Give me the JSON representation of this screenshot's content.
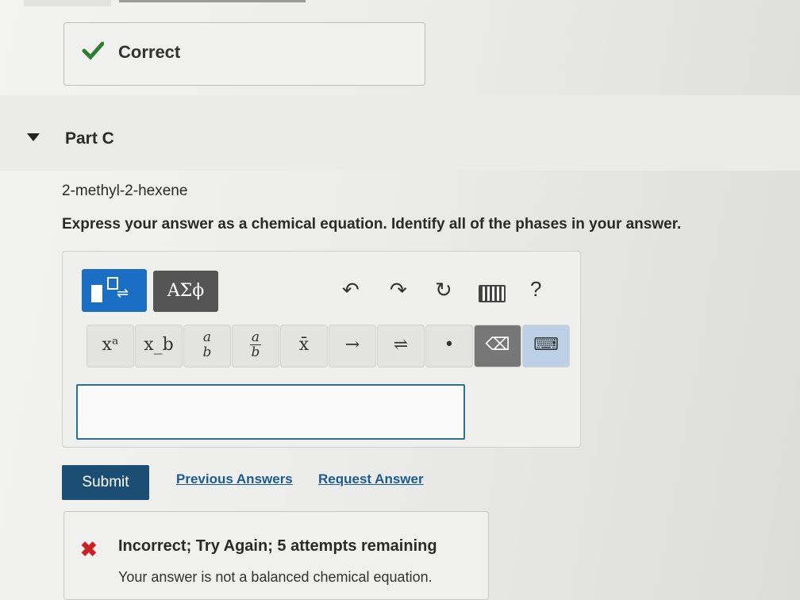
{
  "prev_feedback": {
    "status": "Correct",
    "status_color": "#2e7d32"
  },
  "part": {
    "title": "Part C",
    "compound": "2-methyl-2-hexene",
    "instruction": "Express your answer as a chemical equation. Identify all of the phases in your answer."
  },
  "toolbar": {
    "template_icon": "templates-icon",
    "greek_label": "ΑΣϕ",
    "undo_icon": "↶",
    "redo_icon": "↷",
    "reset_icon": "↻",
    "help_label": "?",
    "keys": [
      {
        "name": "superscript-key",
        "kind": "text",
        "label": "xᵃ"
      },
      {
        "name": "subscript-key",
        "kind": "text",
        "label": "x_b"
      },
      {
        "name": "fraction-ab-key",
        "kind": "frac",
        "num": "a",
        "den": "b"
      },
      {
        "name": "fraction-key",
        "kind": "frac",
        "num": "a",
        "den": "b"
      },
      {
        "name": "overline-key",
        "kind": "text",
        "label": "x̄"
      },
      {
        "name": "arrow-key",
        "kind": "text",
        "label": "→"
      },
      {
        "name": "equilibrium-key",
        "kind": "text",
        "label": "⇌"
      },
      {
        "name": "dot-key",
        "kind": "text",
        "label": "•"
      },
      {
        "name": "backspace-key",
        "kind": "text",
        "label": "⌫"
      },
      {
        "name": "keyboard-key",
        "kind": "text",
        "label": "⌨"
      }
    ]
  },
  "answer_input": {
    "value": ""
  },
  "actions": {
    "submit": "Submit",
    "previous": "Previous Answers",
    "request": "Request Answer"
  },
  "feedback": {
    "title": "Incorrect; Try Again; 5 attempts remaining",
    "message": "Your answer is not a balanced chemical equation.",
    "icon_color": "#cc1f1f"
  }
}
